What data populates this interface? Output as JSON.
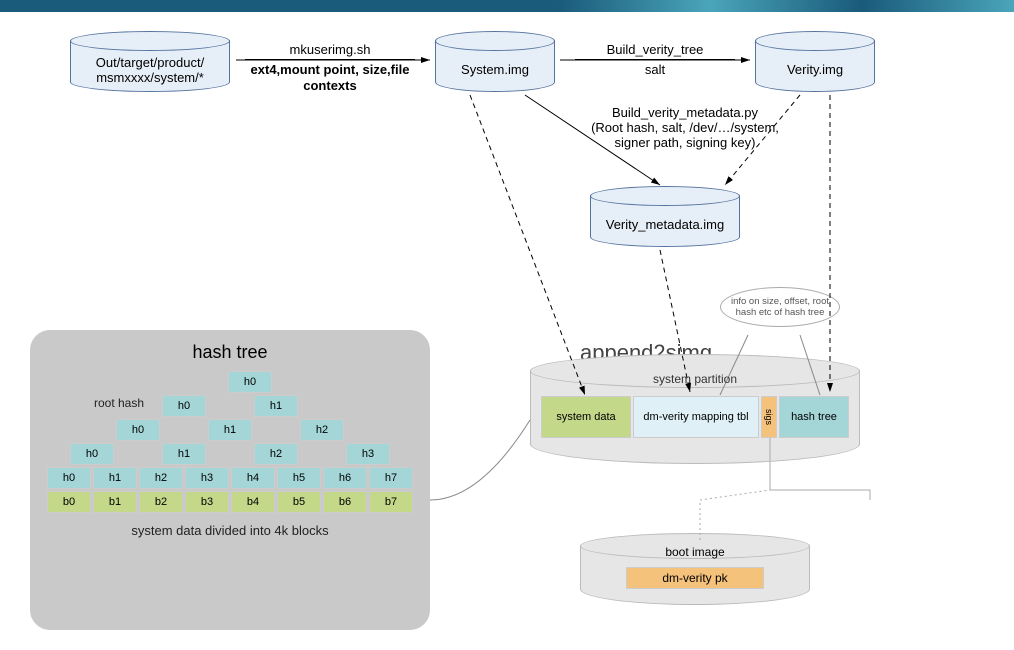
{
  "nodes": {
    "source": {
      "line1": "Out/target/product/",
      "line2": "msmxxxx/system/*"
    },
    "system_img": "System.img",
    "verity_img": "Verity.img",
    "verity_meta": "Verity_metadata.img"
  },
  "edges": {
    "mkuserimg": {
      "top": "mkuserimg.sh",
      "bottom": "ext4,mount point, size,file contexts"
    },
    "build_tree": {
      "top": "Build_verity_tree",
      "bottom": "salt"
    },
    "build_meta": {
      "l1": "Build_verity_metadata.py",
      "l2": "(Root hash, salt, /dev/…/system,",
      "l3": "signer path, signing key)"
    }
  },
  "append": "append2simg",
  "partition": {
    "title": "system partition",
    "c1": "system data",
    "c2": "dm-verity mapping tbl",
    "c3": "sigs",
    "c4": "hash tree"
  },
  "callout": "info on size, offset, root hash etc of hash tree",
  "boot": {
    "title": "boot image",
    "pk": "dm-verity pk"
  },
  "hash_panel": {
    "title": "hash tree",
    "root_label": "root hash",
    "tree": [
      [
        "h0"
      ],
      [
        "h0",
        "h1"
      ],
      [
        "h0",
        "h1",
        "h2"
      ],
      [
        "h0",
        "h1",
        "h2",
        "h3"
      ],
      [
        "h0",
        "h1",
        "h2",
        "h3",
        "h4",
        "h5",
        "h6",
        "h7"
      ],
      [
        "b0",
        "b1",
        "b2",
        "b3",
        "b4",
        "b5",
        "b6",
        "b7"
      ]
    ],
    "caption": "system data divided into 4k blocks"
  }
}
